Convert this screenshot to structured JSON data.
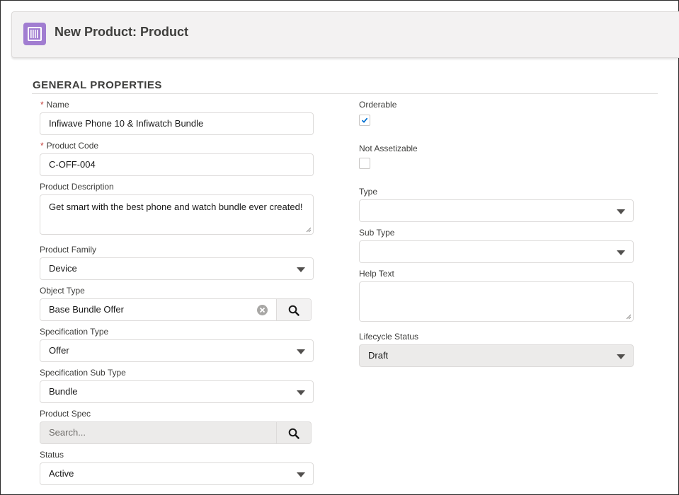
{
  "header": {
    "title": "New Product: Product",
    "icon": "product-icon",
    "icon_color": "#a17dd1"
  },
  "section": {
    "title": "GENERAL PROPERTIES"
  },
  "left": {
    "name": {
      "label": "Name",
      "value": "Infiwave Phone 10 & Infiwatch Bundle",
      "required": true
    },
    "product_code": {
      "label": "Product Code",
      "value": "C-OFF-004",
      "required": true
    },
    "description": {
      "label": "Product Description",
      "value": "Get smart with the best phone and watch bundle ever created!"
    },
    "product_family": {
      "label": "Product Family",
      "value": "Device"
    },
    "object_type": {
      "label": "Object Type",
      "value": "Base Bundle Offer"
    },
    "specification_type": {
      "label": "Specification Type",
      "value": "Offer"
    },
    "specification_sub_type": {
      "label": "Specification Sub Type",
      "value": "Bundle"
    },
    "product_spec": {
      "label": "Product Spec",
      "placeholder": "Search..."
    },
    "status": {
      "label": "Status",
      "value": "Active"
    }
  },
  "right": {
    "orderable": {
      "label": "Orderable",
      "checked": true
    },
    "not_assetizable": {
      "label": "Not Assetizable",
      "checked": false
    },
    "type": {
      "label": "Type",
      "value": ""
    },
    "sub_type": {
      "label": "Sub Type",
      "value": ""
    },
    "help_text": {
      "label": "Help Text",
      "value": ""
    },
    "lifecycle_status": {
      "label": "Lifecycle Status",
      "value": "Draft"
    }
  },
  "colors": {
    "required": "#c23934",
    "check": "#0070d2"
  }
}
